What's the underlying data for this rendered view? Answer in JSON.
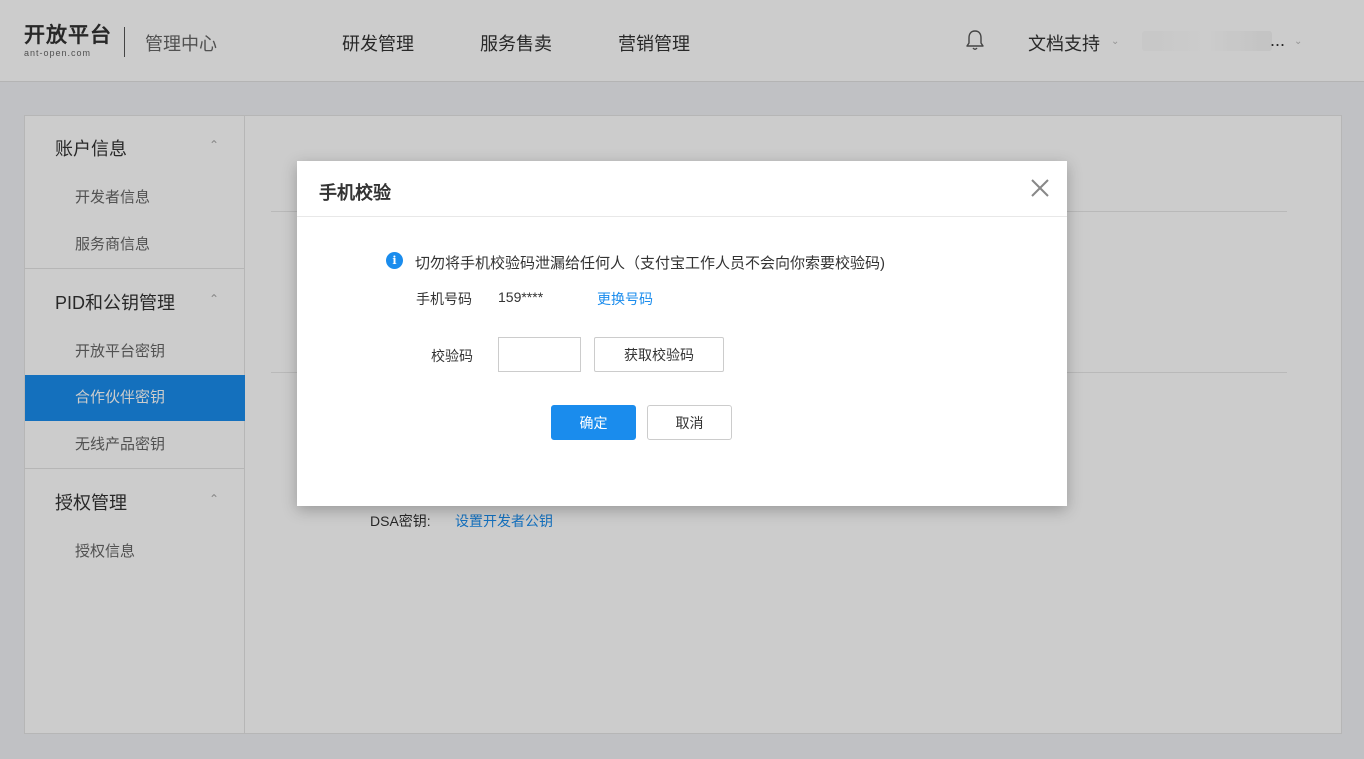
{
  "header": {
    "logo_main": "开放平台",
    "logo_sub": "ant-open.com",
    "title": "管理中心",
    "nav": [
      "研发管理",
      "服务售卖",
      "营销管理"
    ],
    "doc_support": "文档支持",
    "user_ellipsis": "..."
  },
  "sidebar": {
    "groups": [
      {
        "title": "账户信息",
        "items": [
          "开发者信息",
          "服务商信息"
        ]
      },
      {
        "title": "PID和公钥管理",
        "items": [
          "开放平台密钥",
          "合作伙伴密钥",
          "无线产品密钥"
        ]
      },
      {
        "title": "授权管理",
        "items": [
          "授权信息"
        ]
      }
    ],
    "active_item": "合作伙伴密钥"
  },
  "main": {
    "dsa_label": "DSA密钥:",
    "dsa_link": "设置开发者公钥"
  },
  "modal": {
    "title": "手机校验",
    "warning": "切勿将手机校验码泄漏给任何人（支付宝工作人员不会向你索要校验码)",
    "phone_label": "手机号码",
    "phone_value": "159****",
    "change_link": "更换号码",
    "code_label": "校验码",
    "code_value": "",
    "get_code_label": "获取校验码",
    "confirm_label": "确定",
    "cancel_label": "取消"
  },
  "colors": {
    "accent": "#1a8ced",
    "overlay": "rgba(0,0,0,0.2)"
  }
}
